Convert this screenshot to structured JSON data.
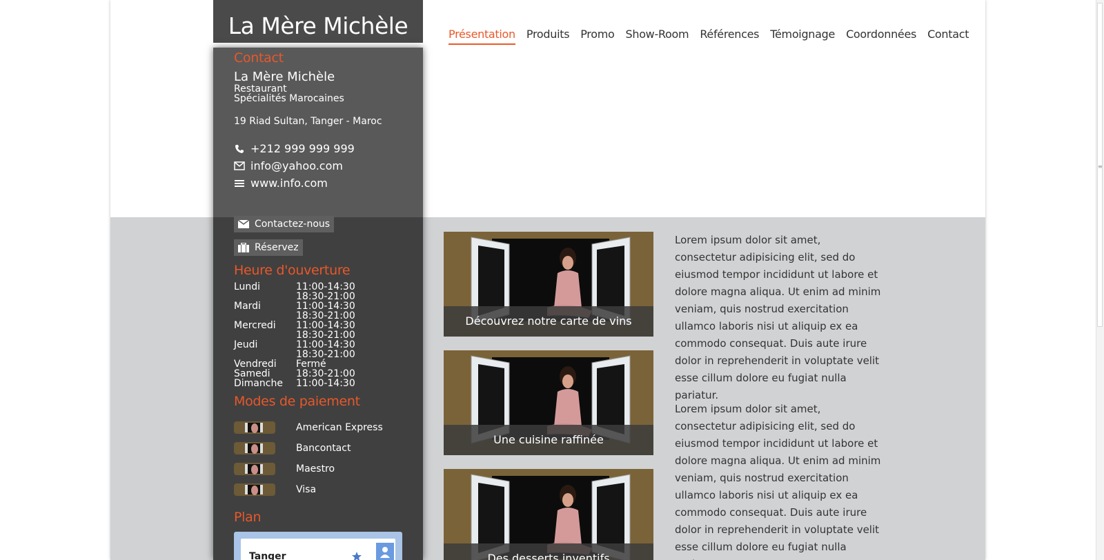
{
  "site": {
    "logo": "La Mère Michèle"
  },
  "nav": [
    {
      "label": "Présentation",
      "active": true
    },
    {
      "label": "Produits"
    },
    {
      "label": "Promo"
    },
    {
      "label": "Show-Room"
    },
    {
      "label": "Références"
    },
    {
      "label": "Témoignage"
    },
    {
      "label": "Coordonnées"
    },
    {
      "label": "Contact"
    }
  ],
  "sidebar": {
    "contact_title": "Contact",
    "business_name": "La Mère Michèle",
    "business_type": "Restaurant",
    "business_specialty": "Spécialités Marocaines",
    "address": "19 Riad Sultan, Tanger - Maroc",
    "phone": "+212 999 999 999",
    "email": "info@yahoo.com",
    "website": "www.info.com",
    "contact_button": "Contactez-nous",
    "reserve_button": "Réservez",
    "hours_title": "Heure d'ouverture",
    "hours": [
      {
        "day": "Lundi",
        "time": "11:00-14:30 18:30-21:00"
      },
      {
        "day": "Mardi",
        "time": "11:00-14:30 18:30-21:00"
      },
      {
        "day": "Mercredi",
        "time": "11:00-14:30 18:30-21:00"
      },
      {
        "day": "Jeudi",
        "time": "11:00-14:30 18:30-21:00"
      },
      {
        "day": "Vendredi",
        "time": "Fermé"
      },
      {
        "day": "Samedi",
        "time": "18:30-21:00"
      },
      {
        "day": "Dimanche",
        "time": "11:00-14:30"
      }
    ],
    "payment_title": "Modes de paiement",
    "payments": [
      "American Express",
      "Bancontact",
      "Maestro",
      "Visa"
    ],
    "plan_title": "Plan",
    "map_label": "Tanger"
  },
  "cards": [
    {
      "caption": "Découvrez notre carte de vins"
    },
    {
      "caption": "Une cuisine raffinée"
    },
    {
      "caption": "Des desserts inventifs"
    }
  ],
  "paragraphs": [
    "Lorem ipsum dolor sit amet, consectetur adipisicing elit, sed do eiusmod tempor incididunt ut labore et dolore magna aliqua. Ut enim ad minim veniam, quis nostrud exercitation ullamco laboris nisi ut aliquip ex ea commodo consequat. Duis aute irure dolor in reprehenderit in voluptate velit esse cillum dolore eu fugiat nulla pariatur.",
    "Lorem ipsum dolor sit amet, consectetur adipisicing elit, sed do eiusmod tempor incididunt ut labore et dolore magna aliqua. Ut enim ad minim veniam, quis nostrud exercitation ullamco laboris nisi ut aliquip ex ea commodo consequat. Duis aute irure dolor in reprehenderit in voluptate velit esse cillum dolore eu fugiat nulla pariatur."
  ],
  "colors": {
    "accent": "#e8582a",
    "sidebar_top": "#595959",
    "sidebar_bottom": "#404040",
    "band": "#d1d2d4"
  },
  "icons": {
    "phone": "phone-icon",
    "email": "envelope-icon",
    "web": "menu-lines-icon",
    "contact_btn": "envelope-icon",
    "reserve_btn": "suitcase-icon",
    "map_star": "star-icon",
    "map_person": "person-icon"
  }
}
